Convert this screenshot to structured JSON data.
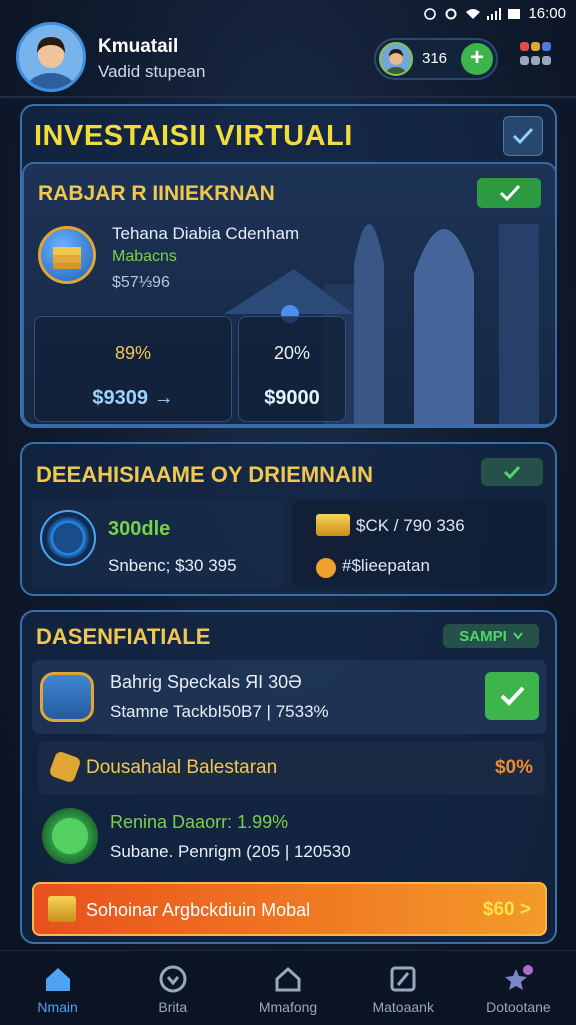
{
  "status_bar": {
    "time": "16:00"
  },
  "header": {
    "username": "Kmuatail",
    "subtitle": "Vadid stupean",
    "coin_value": "316",
    "add_label": "+"
  },
  "colors": {
    "accent_gold": "#f0c850",
    "accent_green": "#3db54a",
    "accent_orange": "#f07a22",
    "border_blue": "#3b6fa8"
  },
  "main_card": {
    "title": "INVESTAISII VIRTUALI",
    "subtitle": "RABJAR R IINIEKRNAN",
    "item_name": "Tehana Diabia Cdenham",
    "item_sub": "Mabacns",
    "item_value": "$57⅓96",
    "stat1": {
      "percent": "89%",
      "amount": "$9309 →"
    },
    "stat2": {
      "percent": "20%",
      "amount": "$9000"
    }
  },
  "second_card": {
    "title": "DEEAHISIAAME OY DRIEMNAIN",
    "left_value": "300dle",
    "left_sub": "Snbenc; $30 395",
    "right_line1": "$CK / 790 336",
    "right_line2": "#$lieepatan"
  },
  "third_card": {
    "title": "DASENFIATIALE",
    "pill_label": "SAMPI",
    "row1_line1": "Bahrig Speckals ЯI 30Ә",
    "row1_line2": "Stamne TackbI50B7 | 7533%",
    "row2_label": "Dousahalal Balestaran",
    "row2_value": "$0%",
    "row3_line1": "Renina Daaorr: 1.99%",
    "row3_line2": "Subane. Penrigm (205 | 120530",
    "cta_label": "Sohoinar Argbckdiuin Mobal",
    "cta_value": "$60 >"
  },
  "nav": {
    "items": [
      {
        "label": "Nmain",
        "icon": "home-icon"
      },
      {
        "label": "Brita",
        "icon": "heart-icon"
      },
      {
        "label": "Mmafong",
        "icon": "house-icon"
      },
      {
        "label": "Matoaank",
        "icon": "note-icon"
      },
      {
        "label": "Dotootane",
        "icon": "star-person-icon"
      }
    ]
  }
}
